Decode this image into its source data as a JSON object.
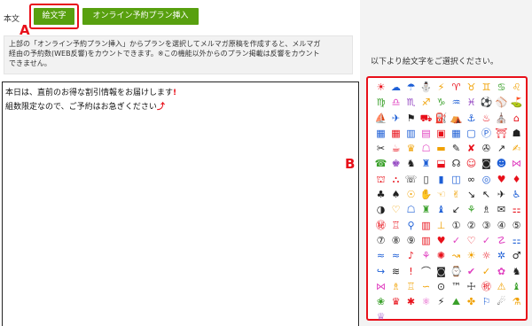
{
  "form": {
    "body_label": "本文",
    "emoji_button": "絵文字",
    "plan_button": "オンライン予約プラン挿入",
    "notice_line1": "上部の「オンライン予約プラン挿入」からプランを選択してメルマガ原稿を作成すると、メルマガ",
    "notice_line2": "経由の予約数(WEB反響)をカウントできます。※この機能以外からのプラン掲載は反響をカウント",
    "notice_line3": "できません。",
    "body_line1": "本日は、直前のお得な割引情報をお届けします",
    "body_line1_mark": "!",
    "body_line2": "組数限定なので、ご予約はお急ぎください",
    "body_line2_mark": "⤴"
  },
  "annotations": {
    "a": "A",
    "b": "B"
  },
  "picker": {
    "hint": "以下より絵文字をご選択ください。",
    "emoji": [
      {
        "g": "☀",
        "c": "#e8101a"
      },
      {
        "g": "☁",
        "c": "#1e5fd6"
      },
      {
        "g": "☂",
        "c": "#1e5fd6"
      },
      {
        "g": "⛄",
        "c": "#1e5fd6"
      },
      {
        "g": "⚡",
        "c": "#f0a000"
      },
      {
        "g": "♈",
        "c": "#e8101a"
      },
      {
        "g": "♉",
        "c": "#f0a000"
      },
      {
        "g": "♊",
        "c": "#f0a000"
      },
      {
        "g": "♋",
        "c": "#3aa02a"
      },
      {
        "g": "♌",
        "c": "#f0a000"
      },
      {
        "g": "♍",
        "c": "#3aa02a"
      },
      {
        "g": "♎",
        "c": "#e040c0"
      },
      {
        "g": "♏",
        "c": "#9040c0"
      },
      {
        "g": "♐",
        "c": "#f0a000"
      },
      {
        "g": "♑",
        "c": "#3aa02a"
      },
      {
        "g": "♒",
        "c": "#1e5fd6"
      },
      {
        "g": "♓",
        "c": "#9040c0"
      },
      {
        "g": "⚽",
        "c": "#222222"
      },
      {
        "g": "⚾",
        "c": "#3aa02a"
      },
      {
        "g": "⛳",
        "c": "#222222"
      },
      {
        "g": "⛵",
        "c": "#1e5fd6"
      },
      {
        "g": "✈",
        "c": "#1e5fd6"
      },
      {
        "g": "⚑",
        "c": "#222222"
      },
      {
        "g": "⛟",
        "c": "#e8101a"
      },
      {
        "g": "⛽",
        "c": "#3aa02a"
      },
      {
        "g": "⛺",
        "c": "#3aa02a"
      },
      {
        "g": "⚓",
        "c": "#1e5fd6"
      },
      {
        "g": "♨",
        "c": "#e8101a"
      },
      {
        "g": "⛪",
        "c": "#3aa02a"
      },
      {
        "g": "⌂",
        "c": "#e8101a"
      },
      {
        "g": "▦",
        "c": "#1e5fd6"
      },
      {
        "g": "▦",
        "c": "#e8101a"
      },
      {
        "g": "▥",
        "c": "#1e5fd6"
      },
      {
        "g": "▤",
        "c": "#e040c0"
      },
      {
        "g": "▣",
        "c": "#e8101a"
      },
      {
        "g": "▦",
        "c": "#1e5fd6"
      },
      {
        "g": "▢",
        "c": "#1e5fd6"
      },
      {
        "g": "Ⓟ",
        "c": "#1e5fd6"
      },
      {
        "g": "⛩",
        "c": "#e8101a"
      },
      {
        "g": "☗",
        "c": "#222222"
      },
      {
        "g": "✂",
        "c": "#222222"
      },
      {
        "g": "☕",
        "c": "#e8101a"
      },
      {
        "g": "♛",
        "c": "#f0a000"
      },
      {
        "g": "☖",
        "c": "#e040c0"
      },
      {
        "g": "▬",
        "c": "#f0a000"
      },
      {
        "g": "✎",
        "c": "#222222"
      },
      {
        "g": "✘",
        "c": "#e8101a"
      },
      {
        "g": "✇",
        "c": "#222222"
      },
      {
        "g": "↗",
        "c": "#222222"
      },
      {
        "g": "✍",
        "c": "#f0a000"
      },
      {
        "g": "☎",
        "c": "#3aa02a"
      },
      {
        "g": "♚",
        "c": "#9040c0"
      },
      {
        "g": "♞",
        "c": "#222222"
      },
      {
        "g": "♜",
        "c": "#1e5fd6"
      },
      {
        "g": "⬓",
        "c": "#e8101a"
      },
      {
        "g": "☊",
        "c": "#222222"
      },
      {
        "g": "☺",
        "c": "#e8101a"
      },
      {
        "g": "◙",
        "c": "#222222"
      },
      {
        "g": "☻",
        "c": "#1e5fd6"
      },
      {
        "g": "⋈",
        "c": "#e040c0"
      },
      {
        "g": "⛫",
        "c": "#e8101a"
      },
      {
        "g": "⛬",
        "c": "#e8101a"
      },
      {
        "g": "☏",
        "c": "#222222"
      },
      {
        "g": "▯",
        "c": "#222222"
      },
      {
        "g": "▮",
        "c": "#1e5fd6"
      },
      {
        "g": "◫",
        "c": "#1e5fd6"
      },
      {
        "g": "∞",
        "c": "#222222"
      },
      {
        "g": "◎",
        "c": "#1e5fd6"
      },
      {
        "g": "♥",
        "c": "#e8101a"
      },
      {
        "g": "♦",
        "c": "#e8101a"
      },
      {
        "g": "♣",
        "c": "#222222"
      },
      {
        "g": "♠",
        "c": "#222222"
      },
      {
        "g": "☉",
        "c": "#f0a000"
      },
      {
        "g": "✋",
        "c": "#f0a000"
      },
      {
        "g": "☜",
        "c": "#f0a000"
      },
      {
        "g": "✌",
        "c": "#f0a000"
      },
      {
        "g": "↘",
        "c": "#222222"
      },
      {
        "g": "↖",
        "c": "#222222"
      },
      {
        "g": "✈",
        "c": "#222222"
      },
      {
        "g": "♿",
        "c": "#1e5fd6"
      },
      {
        "g": "◑",
        "c": "#222222"
      },
      {
        "g": "♡",
        "c": "#f0a000"
      },
      {
        "g": "☖",
        "c": "#1e5fd6"
      },
      {
        "g": "♜",
        "c": "#3aa02a"
      },
      {
        "g": "♝",
        "c": "#1e5fd6"
      },
      {
        "g": "↙",
        "c": "#222222"
      },
      {
        "g": "⚘",
        "c": "#3aa02a"
      },
      {
        "g": "♗",
        "c": "#222222"
      },
      {
        "g": "✉",
        "c": "#222222"
      },
      {
        "g": "⚏",
        "c": "#e8101a"
      },
      {
        "g": "㊙",
        "c": "#e8101a"
      },
      {
        "g": "♖",
        "c": "#e8101a"
      },
      {
        "g": "⚲",
        "c": "#1e5fd6"
      },
      {
        "g": "▥",
        "c": "#e8101a"
      },
      {
        "g": "⊥",
        "c": "#f0a000"
      },
      {
        "g": "①",
        "c": "#222222"
      },
      {
        "g": "②",
        "c": "#222222"
      },
      {
        "g": "③",
        "c": "#222222"
      },
      {
        "g": "④",
        "c": "#222222"
      },
      {
        "g": "⑤",
        "c": "#222222"
      },
      {
        "g": "⑦",
        "c": "#222222"
      },
      {
        "g": "⑧",
        "c": "#222222"
      },
      {
        "g": "⑨",
        "c": "#222222"
      },
      {
        "g": "▥",
        "c": "#e8101a"
      },
      {
        "g": "♥",
        "c": "#e8101a"
      },
      {
        "g": "✓",
        "c": "#e040c0"
      },
      {
        "g": "♡",
        "c": "#e8101a"
      },
      {
        "g": "✓",
        "c": "#e040c0"
      },
      {
        "g": "☡",
        "c": "#e040c0"
      },
      {
        "g": "⚏",
        "c": "#1e5fd6"
      },
      {
        "g": "≈",
        "c": "#1e5fd6"
      },
      {
        "g": "≈",
        "c": "#1e5fd6"
      },
      {
        "g": "♪",
        "c": "#e8101a"
      },
      {
        "g": "⚘",
        "c": "#e040c0"
      },
      {
        "g": "✺",
        "c": "#e8101a"
      },
      {
        "g": "↝",
        "c": "#f0a000"
      },
      {
        "g": "☀",
        "c": "#f0a000"
      },
      {
        "g": "☼",
        "c": "#e8101a"
      },
      {
        "g": "✲",
        "c": "#1e5fd6"
      },
      {
        "g": "♂",
        "c": "#222222"
      },
      {
        "g": "↪",
        "c": "#1e5fd6"
      },
      {
        "g": "≋",
        "c": "#222222"
      },
      {
        "g": "!",
        "c": "#e8101a"
      },
      {
        "g": "⌒",
        "c": "#222222"
      },
      {
        "g": "◙",
        "c": "#222222"
      },
      {
        "g": "⌚",
        "c": "#222222"
      },
      {
        "g": "✔",
        "c": "#e040c0"
      },
      {
        "g": "✓",
        "c": "#f0a000"
      },
      {
        "g": "✿",
        "c": "#e040c0"
      },
      {
        "g": "♞",
        "c": "#222222"
      },
      {
        "g": "⋈",
        "c": "#e040c0"
      },
      {
        "g": "♗",
        "c": "#f0a000"
      },
      {
        "g": "♖",
        "c": "#f0a000"
      },
      {
        "g": "∽",
        "c": "#f0a000"
      },
      {
        "g": "⊙",
        "c": "#222222"
      },
      {
        "g": "™",
        "c": "#222222"
      },
      {
        "g": "☩",
        "c": "#222222"
      },
      {
        "g": "㊗",
        "c": "#e8101a"
      },
      {
        "g": "⚠",
        "c": "#f0a000"
      },
      {
        "g": "♝",
        "c": "#3aa02a"
      },
      {
        "g": "❀",
        "c": "#3aa02a"
      },
      {
        "g": "♛",
        "c": "#e8101a"
      },
      {
        "g": "✱",
        "c": "#e8101a"
      },
      {
        "g": "⚛",
        "c": "#e040c0"
      },
      {
        "g": "⚡",
        "c": "#222222"
      },
      {
        "g": "⛰",
        "c": "#3aa02a"
      },
      {
        "g": "✤",
        "c": "#f0a000"
      },
      {
        "g": "⚐",
        "c": "#1e5fd6"
      },
      {
        "g": "☄",
        "c": "#222222"
      },
      {
        "g": "⚗",
        "c": "#f0a000"
      },
      {
        "g": "♕",
        "c": "#9040c0"
      }
    ]
  }
}
